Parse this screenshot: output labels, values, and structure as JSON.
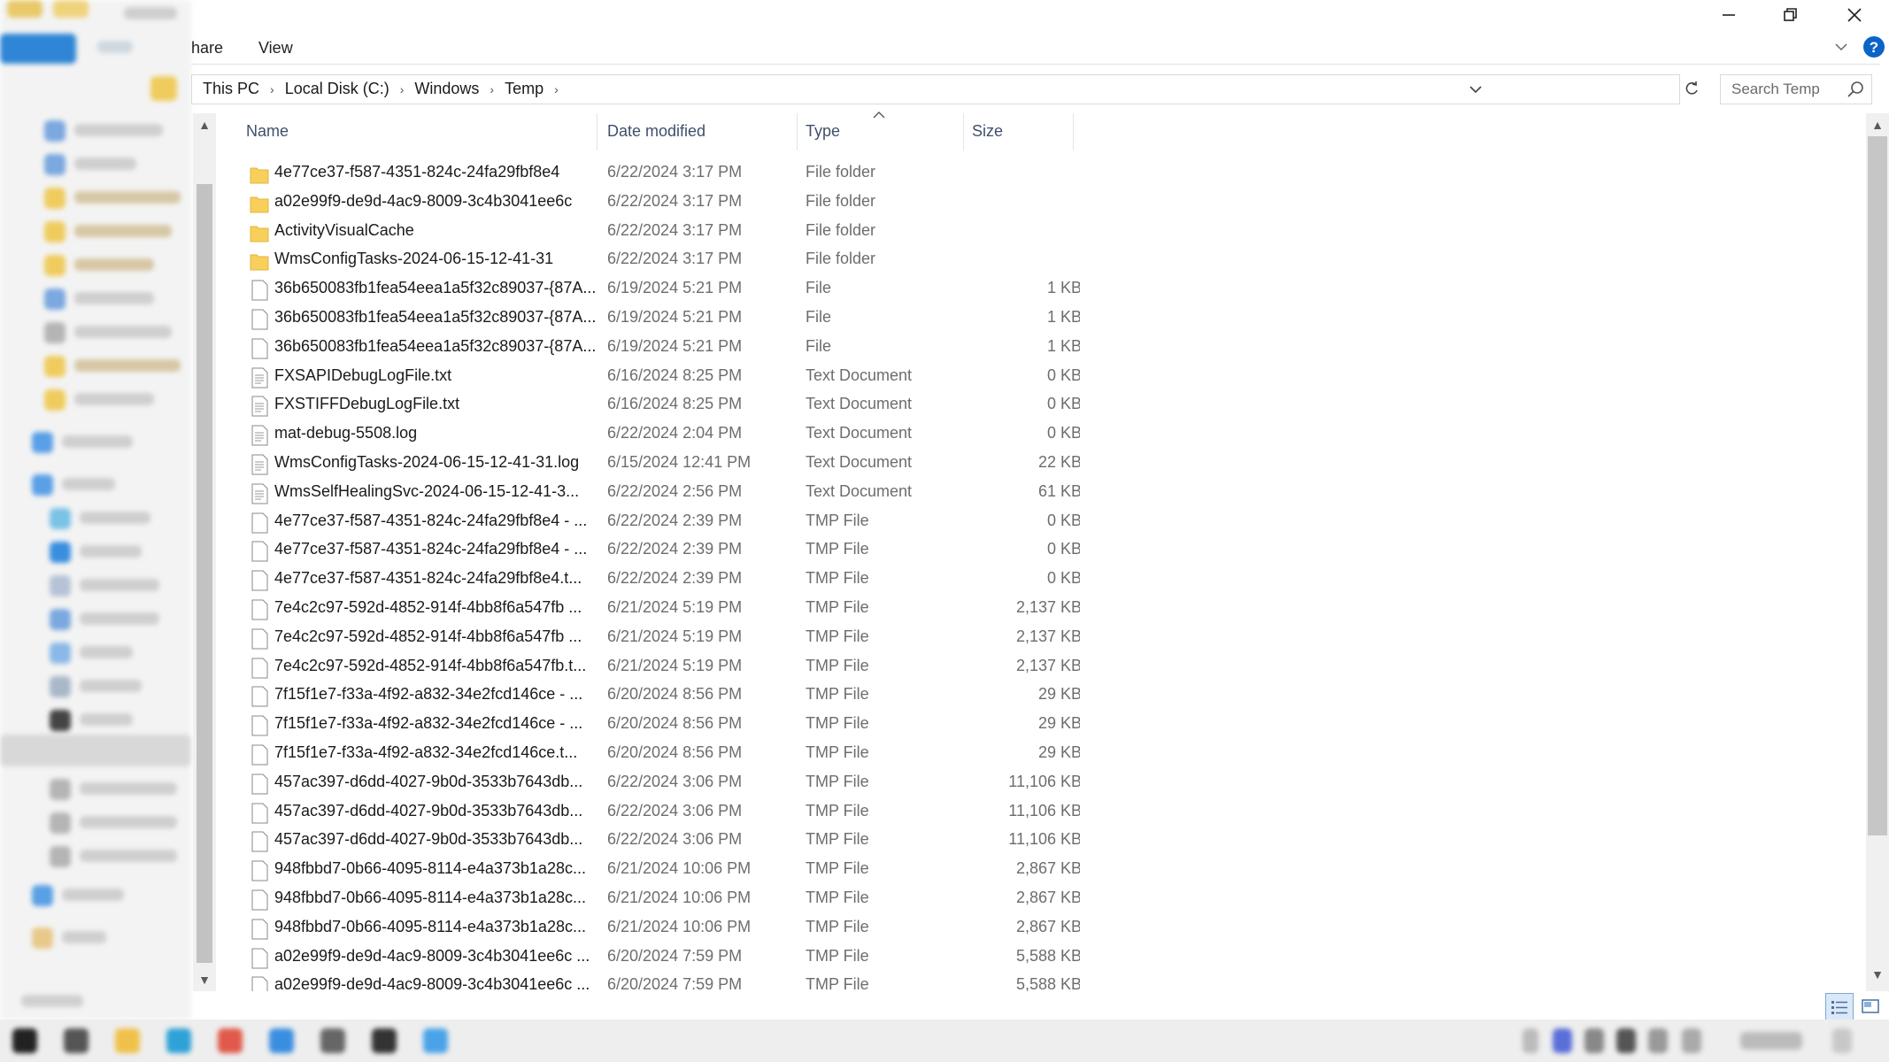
{
  "window": {
    "ribbon_tabs": [
      "hare",
      "View"
    ]
  },
  "address": {
    "crumbs": [
      "This PC",
      "Local Disk (C:)",
      "Windows",
      "Temp"
    ]
  },
  "search": {
    "placeholder": "Search Temp"
  },
  "columns": {
    "name": "Name",
    "date": "Date modified",
    "type": "Type",
    "size": "Size"
  },
  "files": [
    {
      "icon": "folder",
      "name": "4e77ce37-f587-4351-824c-24fa29fbf8e4",
      "date": "6/22/2024 3:17 PM",
      "type": "File folder",
      "size": ""
    },
    {
      "icon": "folder",
      "name": "a02e99f9-de9d-4ac9-8009-3c4b3041ee6c",
      "date": "6/22/2024 3:17 PM",
      "type": "File folder",
      "size": ""
    },
    {
      "icon": "folder",
      "name": "ActivityVisualCache",
      "date": "6/22/2024 3:17 PM",
      "type": "File folder",
      "size": ""
    },
    {
      "icon": "folder",
      "name": "WmsConfigTasks-2024-06-15-12-41-31",
      "date": "6/22/2024 3:17 PM",
      "type": "File folder",
      "size": ""
    },
    {
      "icon": "file",
      "name": "36b650083fb1fea54eea1a5f32c89037-{87A...",
      "date": "6/19/2024 5:21 PM",
      "type": "File",
      "size": "1 KB"
    },
    {
      "icon": "file",
      "name": "36b650083fb1fea54eea1a5f32c89037-{87A...",
      "date": "6/19/2024 5:21 PM",
      "type": "File",
      "size": "1 KB"
    },
    {
      "icon": "file",
      "name": "36b650083fb1fea54eea1a5f32c89037-{87A...",
      "date": "6/19/2024 5:21 PM",
      "type": "File",
      "size": "1 KB"
    },
    {
      "icon": "text",
      "name": "FXSAPIDebugLogFile.txt",
      "date": "6/16/2024 8:25 PM",
      "type": "Text Document",
      "size": "0 KB"
    },
    {
      "icon": "text",
      "name": "FXSTIFFDebugLogFile.txt",
      "date": "6/16/2024 8:25 PM",
      "type": "Text Document",
      "size": "0 KB"
    },
    {
      "icon": "text",
      "name": "mat-debug-5508.log",
      "date": "6/22/2024 2:04 PM",
      "type": "Text Document",
      "size": "0 KB"
    },
    {
      "icon": "text",
      "name": "WmsConfigTasks-2024-06-15-12-41-31.log",
      "date": "6/15/2024 12:41 PM",
      "type": "Text Document",
      "size": "22 KB"
    },
    {
      "icon": "text",
      "name": "WmsSelfHealingSvc-2024-06-15-12-41-3...",
      "date": "6/22/2024 2:56 PM",
      "type": "Text Document",
      "size": "61 KB"
    },
    {
      "icon": "file",
      "name": "4e77ce37-f587-4351-824c-24fa29fbf8e4 - ...",
      "date": "6/22/2024 2:39 PM",
      "type": "TMP File",
      "size": "0 KB"
    },
    {
      "icon": "file",
      "name": "4e77ce37-f587-4351-824c-24fa29fbf8e4 - ...",
      "date": "6/22/2024 2:39 PM",
      "type": "TMP File",
      "size": "0 KB"
    },
    {
      "icon": "file",
      "name": "4e77ce37-f587-4351-824c-24fa29fbf8e4.t...",
      "date": "6/22/2024 2:39 PM",
      "type": "TMP File",
      "size": "0 KB"
    },
    {
      "icon": "file",
      "name": "7e4c2c97-592d-4852-914f-4bb8f6a547fb ...",
      "date": "6/21/2024 5:19 PM",
      "type": "TMP File",
      "size": "2,137 KB"
    },
    {
      "icon": "file",
      "name": "7e4c2c97-592d-4852-914f-4bb8f6a547fb ...",
      "date": "6/21/2024 5:19 PM",
      "type": "TMP File",
      "size": "2,137 KB"
    },
    {
      "icon": "file",
      "name": "7e4c2c97-592d-4852-914f-4bb8f6a547fb.t...",
      "date": "6/21/2024 5:19 PM",
      "type": "TMP File",
      "size": "2,137 KB"
    },
    {
      "icon": "file",
      "name": "7f15f1e7-f33a-4f92-a832-34e2fcd146ce - ...",
      "date": "6/20/2024 8:56 PM",
      "type": "TMP File",
      "size": "29 KB"
    },
    {
      "icon": "file",
      "name": "7f15f1e7-f33a-4f92-a832-34e2fcd146ce - ...",
      "date": "6/20/2024 8:56 PM",
      "type": "TMP File",
      "size": "29 KB"
    },
    {
      "icon": "file",
      "name": "7f15f1e7-f33a-4f92-a832-34e2fcd146ce.t...",
      "date": "6/20/2024 8:56 PM",
      "type": "TMP File",
      "size": "29 KB"
    },
    {
      "icon": "file",
      "name": "457ac397-d6dd-4027-9b0d-3533b7643db...",
      "date": "6/22/2024 3:06 PM",
      "type": "TMP File",
      "size": "11,106 KB"
    },
    {
      "icon": "file",
      "name": "457ac397-d6dd-4027-9b0d-3533b7643db...",
      "date": "6/22/2024 3:06 PM",
      "type": "TMP File",
      "size": "11,106 KB"
    },
    {
      "icon": "file",
      "name": "457ac397-d6dd-4027-9b0d-3533b7643db...",
      "date": "6/22/2024 3:06 PM",
      "type": "TMP File",
      "size": "11,106 KB"
    },
    {
      "icon": "file",
      "name": "948fbbd7-0b66-4095-8114-e4a373b1a28c...",
      "date": "6/21/2024 10:06 PM",
      "type": "TMP File",
      "size": "2,867 KB"
    },
    {
      "icon": "file",
      "name": "948fbbd7-0b66-4095-8114-e4a373b1a28c...",
      "date": "6/21/2024 10:06 PM",
      "type": "TMP File",
      "size": "2,867 KB"
    },
    {
      "icon": "file",
      "name": "948fbbd7-0b66-4095-8114-e4a373b1a28c...",
      "date": "6/21/2024 10:06 PM",
      "type": "TMP File",
      "size": "2,867 KB"
    },
    {
      "icon": "file",
      "name": "a02e99f9-de9d-4ac9-8009-3c4b3041ee6c ...",
      "date": "6/20/2024 7:59 PM",
      "type": "TMP File",
      "size": "5,588 KB"
    },
    {
      "icon": "file",
      "name": "a02e99f9-de9d-4ac9-8009-3c4b3041ee6c ...",
      "date": "6/20/2024 7:59 PM",
      "type": "TMP File",
      "size": "5,588 KB"
    }
  ],
  "colors": {
    "folder": "#f8cf5a",
    "accent": "#0a64c8",
    "header_text": "#40506a"
  }
}
